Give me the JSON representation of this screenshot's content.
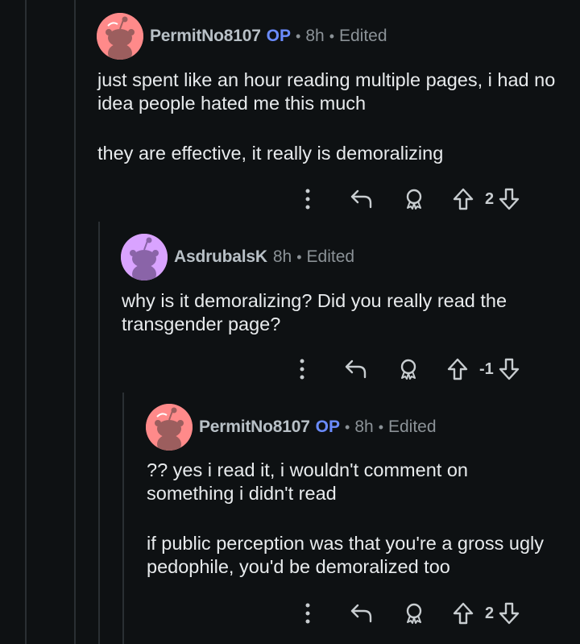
{
  "comments": [
    {
      "username": "PermitNo8107",
      "op_badge": "OP",
      "time": "8h",
      "edited": "Edited",
      "paragraphs": [
        "just spent like an hour reading multiple pages, i had no idea people hated me this much",
        "they are effective, it really is demoralizing"
      ],
      "score": "2",
      "avatar_color": "#ff8a8a"
    },
    {
      "username": "AsdrubalsK",
      "time": "8h",
      "edited": "Edited",
      "paragraphs": [
        "why is it demoralizing? Did you really read the transgender page?"
      ],
      "score": "-1",
      "avatar_color": "#d9a3ff"
    },
    {
      "username": "PermitNo8107",
      "op_badge": "OP",
      "time": "8h",
      "edited": "Edited",
      "paragraphs": [
        "?? yes i read it, i wouldn't comment on something i didn't read",
        "if public perception was that you're a gross ugly pedophile, you'd be demoralized too"
      ],
      "score": "2",
      "avatar_color": "#ff8a8a"
    }
  ],
  "icons": {
    "more": "more-vertical-icon",
    "reply": "reply-icon",
    "award": "award-icon",
    "upvote": "upvote-icon",
    "downvote": "downvote-icon"
  },
  "colors": {
    "background": "#0e1113",
    "op_badge": "#6b8cff",
    "thread_line": "#2a2f33"
  }
}
